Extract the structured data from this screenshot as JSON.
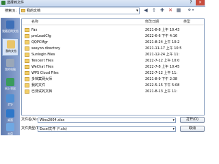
{
  "window": {
    "title": "选择到文件",
    "help_icon": "?",
    "close_icon": "×"
  },
  "toolbar": {
    "lookin_label": "搜索(I):",
    "lookin_value": "我的文档",
    "icons": [
      "back-icon",
      "up-folder-icon",
      "new-folder-icon",
      "delete-icon",
      "views-icon",
      "tools-icon"
    ]
  },
  "places": [
    {
      "label": "我最近的文档",
      "color": "#3d6fb8"
    },
    {
      "label": "我的文档",
      "color": "#e9c46a"
    },
    {
      "label": "我的电脑",
      "color": "#9aa7b8"
    },
    {
      "label": "网上邻居",
      "color": "#3a9b5c"
    },
    {
      "label": "FTP",
      "color": "#4f8fd3"
    },
    {
      "label": "桌面",
      "color": "#2e77c9"
    },
    {
      "label": "云盘",
      "color": "#6fa8e3"
    }
  ],
  "list": {
    "columns": {
      "name": "名称",
      "date": "修改日期",
      "type": "类型"
    },
    "rows": [
      {
        "name": "Fax",
        "date": "2021-8-8 上午 10:43"
      },
      {
        "name": "preLoadCfg",
        "date": "2022-6-6 下午 4:16"
      },
      {
        "name": "QQPCMgr",
        "date": "2021-8-24 上午 10:2"
      },
      {
        "name": "seeyon directory",
        "date": "2021-11-17 上午 10:5"
      },
      {
        "name": "Sunlogin Files",
        "date": "2021-12-24 上午 11:"
      },
      {
        "name": "Tencent Files",
        "date": "2022-7-12 上午 10:0"
      },
      {
        "name": "WeChat Files",
        "date": "2022-7-8 上午 10:45"
      },
      {
        "name": "WPS Cloud Files",
        "date": "2022-7-12 上午 11:"
      },
      {
        "name": "多档案网大师",
        "date": "2021-8-9 下午 2:38"
      },
      {
        "name": "我的文件",
        "date": "2022-5-15 下午 5:08"
      },
      {
        "name": "已测试的文档",
        "date": "2021-8-13 上午 11:"
      }
    ]
  },
  "footer": {
    "filename_label": "文件名(N):",
    "filename_value": "Wins2004.xlsx",
    "filetype_label": "文件类型(T):",
    "filetype_value": "Excel文件 (*.xls)",
    "open_label": "打开(O)",
    "cancel_label": "取消"
  }
}
